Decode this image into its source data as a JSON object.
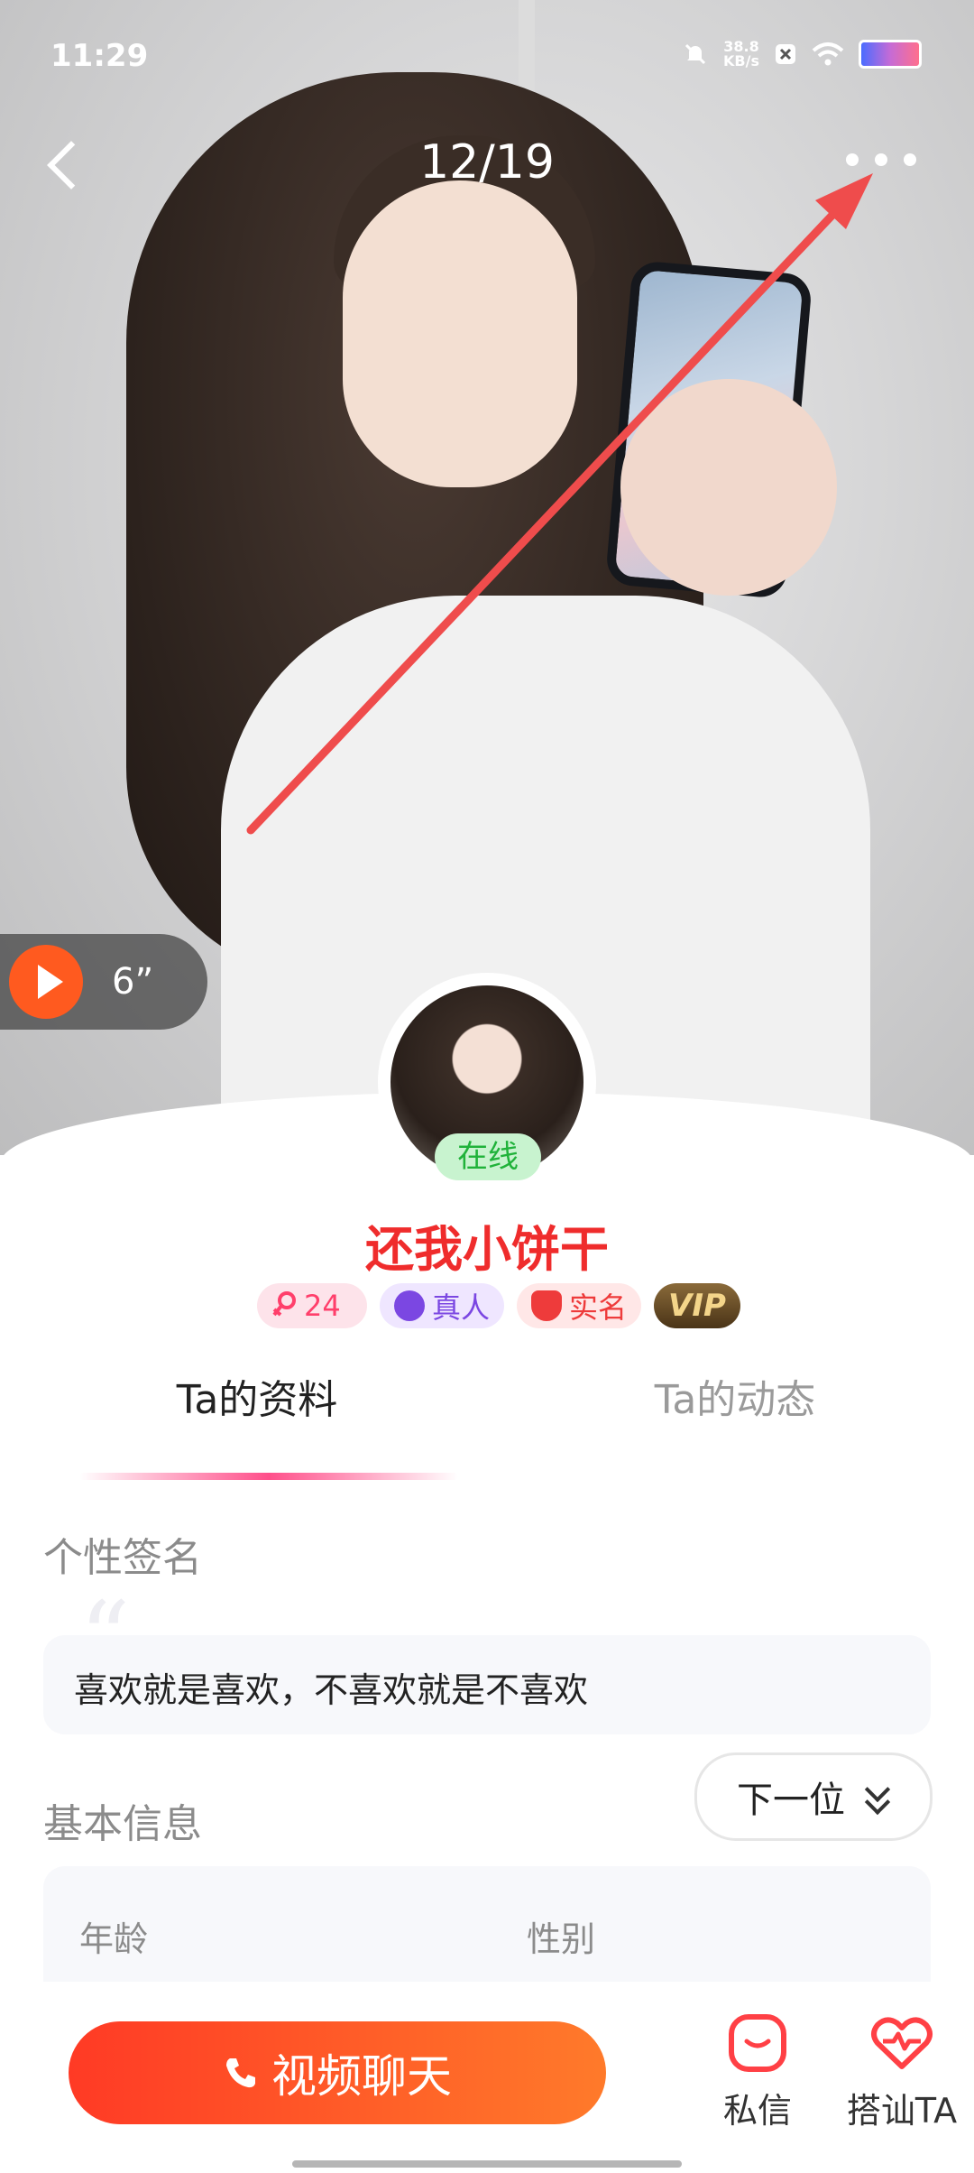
{
  "status_bar": {
    "time": "11:29",
    "net_speed_value": "38.8",
    "net_speed_unit": "KB/s",
    "battery_color": "#6b6bff"
  },
  "header": {
    "photo_counter": "12/19",
    "back_icon": "chevron-left-icon",
    "more_icon": "more-dots-icon"
  },
  "voice": {
    "duration": "6”",
    "icon": "play-icon",
    "accent": "#ff5a1f"
  },
  "profile": {
    "online_label": "在线",
    "name": "还我小饼干",
    "badges": {
      "age": "24",
      "real_person": "真人",
      "real_name": "实名",
      "vip": "VIP"
    }
  },
  "tabs": [
    {
      "label": "Ta的资料",
      "active": true
    },
    {
      "label": "Ta的动态",
      "active": false
    }
  ],
  "signature": {
    "section_title": "个性签名",
    "text": "喜欢就是喜欢，不喜欢就是不喜欢"
  },
  "next_button": {
    "label": "下一位",
    "icon": "double-chevron-down-icon"
  },
  "basic_info": {
    "section_title": "基本信息",
    "fields": [
      {
        "label": "年龄"
      },
      {
        "label": "性别"
      }
    ]
  },
  "bottom_bar": {
    "call_label": "视频聊天",
    "call_icon": "phone-icon",
    "message_label": "私信",
    "flirt_label": "搭讪TA",
    "accent": "#ff4045"
  }
}
